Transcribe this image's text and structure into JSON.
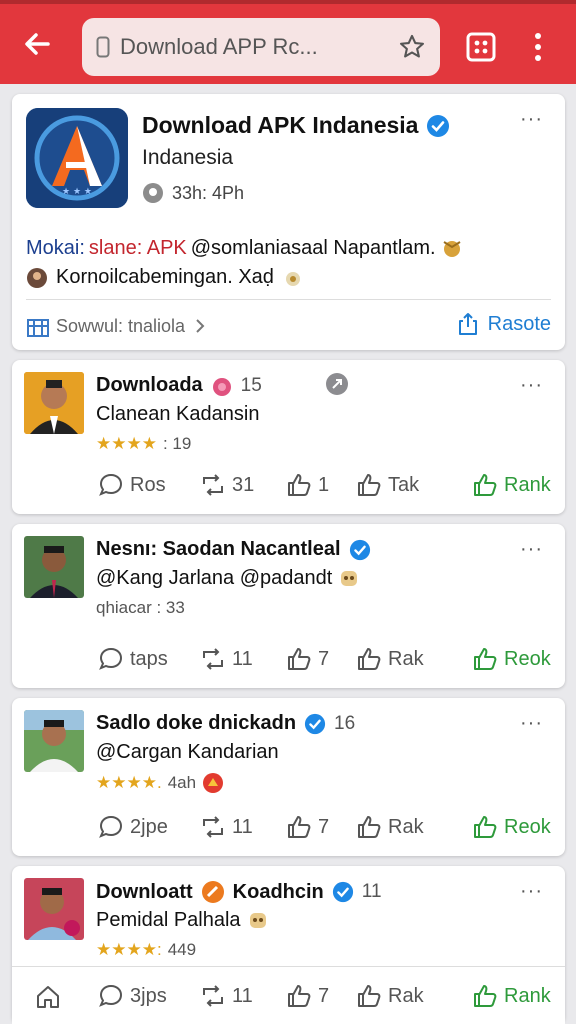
{
  "browser": {
    "url_text": "Download APP Rc...",
    "colors": {
      "bar": "#e2373d",
      "url_bg": "#f6e4e4"
    }
  },
  "app_card": {
    "title": "Download APK Indanesia",
    "subtitle": "Indanesia",
    "meta": "33h: 4Ph",
    "desc_label": "Mokai:",
    "desc_red": "slane: APK",
    "desc_rest": "@somlaniasaal Napantlam.",
    "desc2": "Kornoilcabemingan. Xaḍ",
    "share_label": "Sowwul: tnaliola",
    "rasote_label": "Rasote",
    "more": "···"
  },
  "posts": [
    {
      "name": "Downloada",
      "count": "15",
      "line2": "Clanean Kadansin",
      "stars": "★★★★",
      "line3": ": 19",
      "actions": {
        "comment": "Ros",
        "repost": "31",
        "like": "1",
        "tak": "Tak",
        "rank": "Rank"
      }
    },
    {
      "name": "Nesnı: Saodan Nacantleal",
      "count": "",
      "line2": "@Kang Jarlana @padandt",
      "stars": "",
      "line3": "qhiacar : 33",
      "actions": {
        "comment": "taps",
        "repost": "11",
        "like": "7",
        "tak": "Rak",
        "rank": "Reok"
      }
    },
    {
      "name": "Sadlo doke dnickadn",
      "count": "16",
      "line2": "@Cargan Kandarian",
      "stars": "★★★★.",
      "line3": "4ah",
      "actions": {
        "comment": "2jpe",
        "repost": "11",
        "like": "7",
        "tak": "Rak",
        "rank": "Reok"
      }
    },
    {
      "name": "Downloatt",
      "name2": "Koadhcin",
      "count": "11",
      "line2": "Pemidal Palhala",
      "stars": "★★★★:",
      "line3": "449",
      "actions": {
        "comment": "3jps",
        "repost": "11",
        "like": "7",
        "tak": "Rak",
        "rank": "Rank"
      }
    }
  ]
}
